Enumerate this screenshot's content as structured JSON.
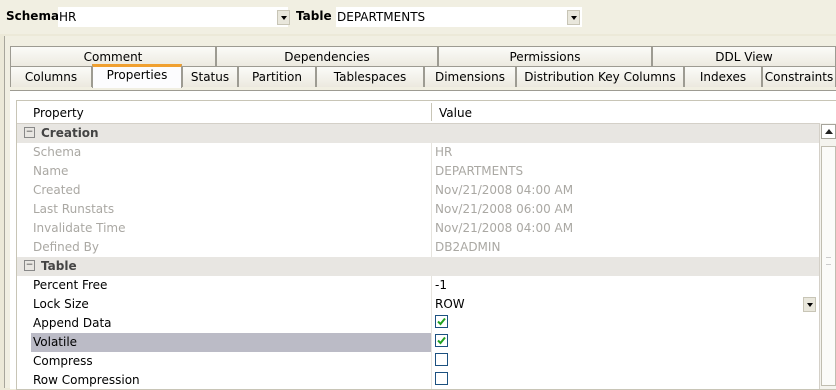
{
  "header": {
    "schema_label": "Schema",
    "schema_value": "HR",
    "table_label": "Table",
    "table_value": "DEPARTMENTS"
  },
  "tabs_top": [
    "Comment",
    "Dependencies",
    "Permissions",
    "DDL View"
  ],
  "tabs_bottom": [
    "Columns",
    "Properties",
    "Status",
    "Partition",
    "Tablespaces",
    "Dimensions",
    "Distribution Key Columns",
    "Indexes",
    "Constraints"
  ],
  "active_tab": "Properties",
  "grid": {
    "col_property": "Property",
    "col_value": "Value",
    "creation": {
      "label": "Creation",
      "rows": [
        {
          "name": "Schema",
          "value": "HR"
        },
        {
          "name": "Name",
          "value": "DEPARTMENTS"
        },
        {
          "name": "Created",
          "value": "Nov/21/2008 04:00 AM"
        },
        {
          "name": "Last Runstats",
          "value": "Nov/21/2008 06:00 AM"
        },
        {
          "name": "Invalidate Time",
          "value": "Nov/21/2008 04:00 AM"
        },
        {
          "name": "Defined By",
          "value": "DB2ADMIN"
        }
      ]
    },
    "table": {
      "label": "Table",
      "percent_free": {
        "name": "Percent Free",
        "value": "-1"
      },
      "lock_size": {
        "name": "Lock Size",
        "value": "ROW"
      },
      "append_data": {
        "name": "Append Data",
        "checked": true
      },
      "volatile": {
        "name": "Volatile",
        "checked": true
      },
      "compress": {
        "name": "Compress",
        "checked": false
      },
      "row_compression": {
        "name": "Row Compression",
        "checked": false
      }
    }
  },
  "colors": {
    "tab_accent": "#f0a030",
    "selected_row": "#bbbbc6",
    "category_bg": "#e8e6e2"
  }
}
